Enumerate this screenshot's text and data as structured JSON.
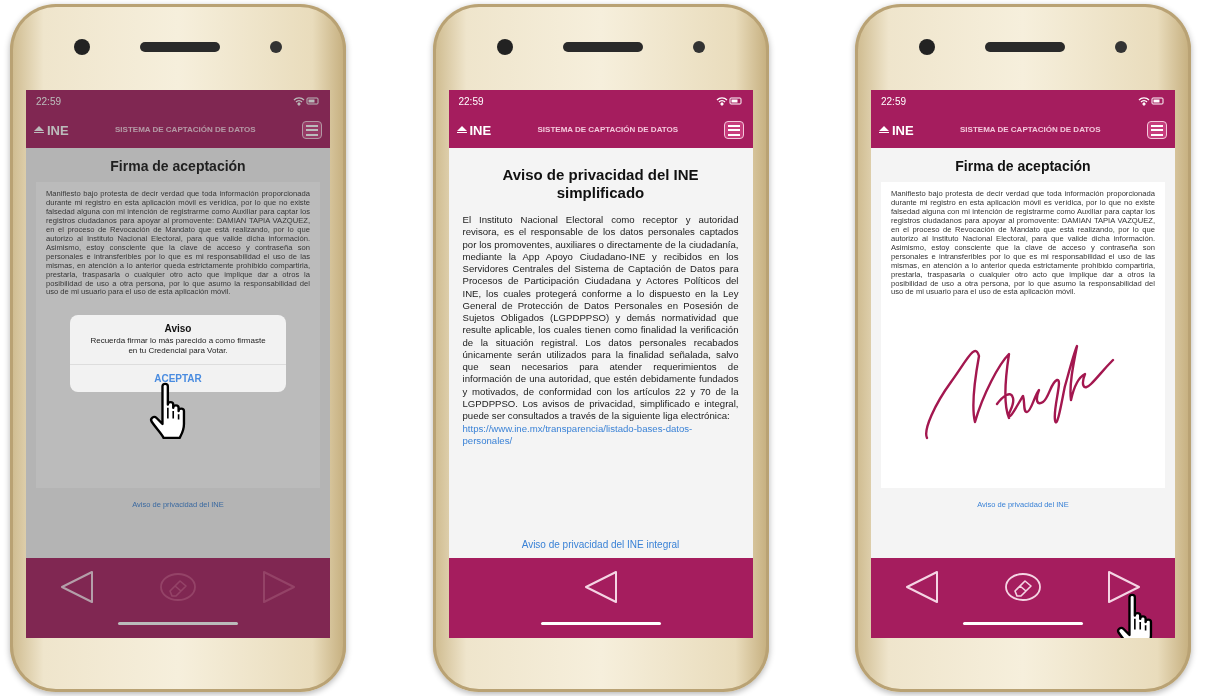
{
  "phones": [
    {
      "kind": "signature",
      "status_bar": {
        "time": "22:59"
      },
      "header": {
        "logo": "INE",
        "title": "SISTEMA DE CAPTACIÓN DE DATOS"
      },
      "screen_title": "Firma de aceptación",
      "body": "Manifiesto bajo protesta de decir verdad que toda información proporcionada durante mi registro en esta aplicación móvil es verídica, por lo que no existe falsedad alguna con mi intención de registrarme como Auxiliar para captar los registros ciudadanos para apoyar al promovente: DAMIAN TAPIA VAZQUEZ, en el proceso de Revocación de Mandato que está realizando, por lo que autorizo al Instituto Nacional Electoral, para que valide dicha información. Asimismo, estoy consciente que la clave de acceso y contraseña son personales e intransferibles por lo que es mi responsabilidad el uso de las mismas, en atención a lo anterior queda estrictamente prohibido compartirla, prestarla, traspasarla o cualquier otro acto que implique dar a otros la posibilidad de uso a otra persona, por lo que asumo la responsabilidad del uso de mi usuario para el uso de esta aplicación móvil.",
      "signed": false,
      "dialog": {
        "title": "Aviso",
        "message": "Recuerda firmar lo más parecido a como firmaste en tu Credencial para Votar.",
        "button": "ACEPTAR",
        "pointed": true
      },
      "link": "Aviso de privacidad del INE",
      "nav": [
        {
          "kind": "back",
          "disabled": false,
          "pointed": false
        },
        {
          "kind": "erase",
          "disabled": true,
          "pointed": false
        },
        {
          "kind": "next",
          "disabled": true,
          "pointed": false
        }
      ]
    },
    {
      "kind": "privacy",
      "status_bar": {
        "time": "22:59"
      },
      "header": {
        "logo": "INE",
        "title": "SISTEMA DE CAPTACIÓN DE DATOS"
      },
      "screen_title": "Aviso de privacidad del INE simplificado",
      "body": "El Instituto Nacional Electoral como receptor y autoridad revisora, es el responsable de los datos personales captados por los promoventes, auxiliares o directamente de la ciudadanía, mediante la App Apoyo Ciudadano-INE y recibidos en los Servidores Centrales del Sistema de Captación de Datos para Procesos de Participación Ciudadana y Actores Políticos del INE, los cuales protegerá conforme a lo dispuesto en la Ley General de Protección de Datos Personales en Posesión de Sujetos Obligados (LGPDPPSO) y demás normatividad que resulte aplicable, los cuales tienen como finalidad la verificación de la situación registral. Los datos personales recabados únicamente serán utilizados para la finalidad señalada, salvo que sean necesarios para atender requerimientos de información de una autoridad, que estén debidamente fundados y motivados, de conformidad con los artículos 22 y 70 de la LGPDPPSO. Los avisos de privacidad, simplificado e integral, puede ser consultados a través de la siguiente liga electrónica:",
      "body_link": "https://www.ine.mx/transparencia/listado-bases-datos-personales/",
      "link": "Aviso de privacidad del INE integral",
      "nav": [
        {
          "kind": "back",
          "disabled": false,
          "pointed": false
        }
      ]
    },
    {
      "kind": "signature",
      "status_bar": {
        "time": "22:59"
      },
      "header": {
        "logo": "INE",
        "title": "SISTEMA DE CAPTACIÓN DE DATOS"
      },
      "screen_title": "Firma de aceptación",
      "body": "Manifiesto bajo protesta de decir verdad que toda información proporcionada durante mi registro en esta aplicación móvil es verídica, por lo que no existe falsedad alguna con mi intención de registrarme como Auxiliar para captar los registros ciudadanos para apoyar al promovente: DAMIAN TAPIA VAZQUEZ, en el proceso de Revocación de Mandato que está realizando, por lo que autorizo al Instituto Nacional Electoral, para que valide dicha información. Asimismo, estoy consciente que la clave de acceso y contraseña son personales e intransferibles por lo que es mi responsabilidad el uso de las mismas, en atención a lo anterior queda estrictamente prohibido compartirla, prestarla, traspasarla o cualquier otro acto que implique dar a otros la posibilidad de uso a otra persona, por lo que asumo la responsabilidad del uso de mi usuario para el uso de esta aplicación móvil.",
      "signed": true,
      "link": "Aviso de privacidad del INE",
      "nav": [
        {
          "kind": "back",
          "disabled": false,
          "pointed": false
        },
        {
          "kind": "erase",
          "disabled": false,
          "pointed": false
        },
        {
          "kind": "next",
          "disabled": false,
          "pointed": true
        }
      ]
    }
  ]
}
